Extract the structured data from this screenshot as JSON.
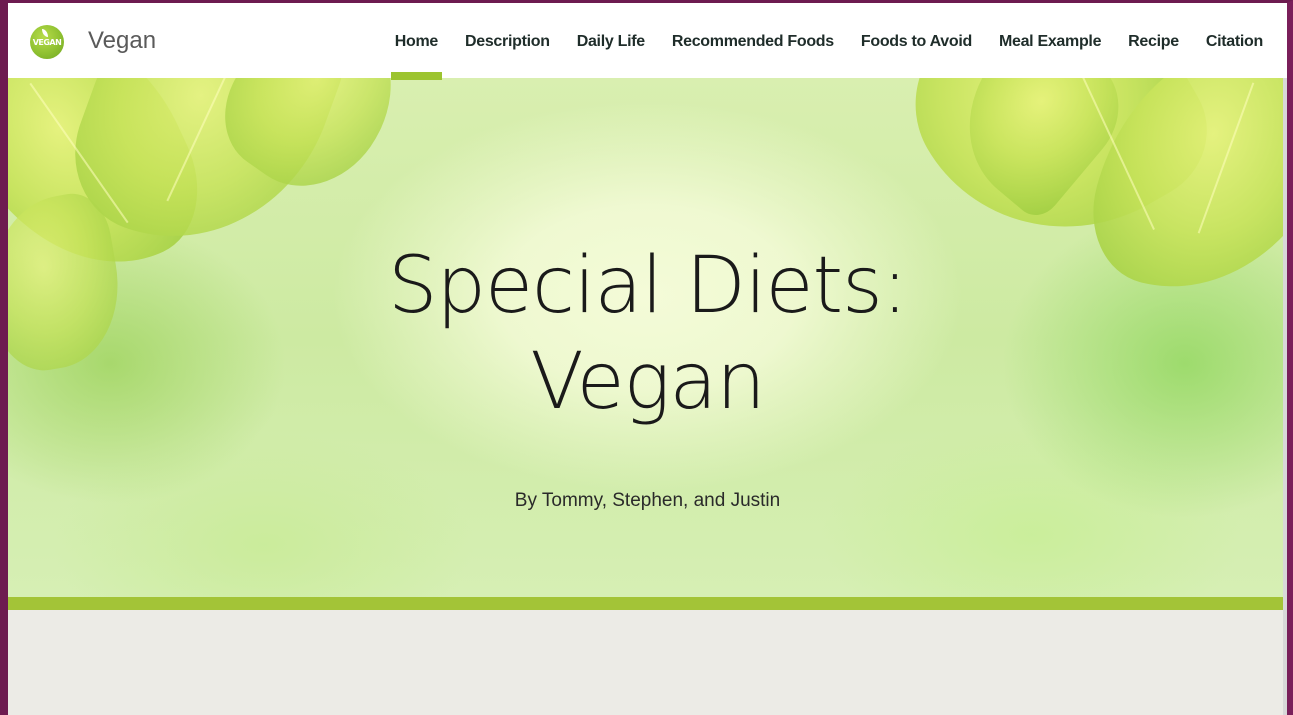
{
  "site": {
    "logo_icon": "vegan-logo-icon",
    "logo_text": "VEGAN",
    "title": "Vegan",
    "accent_color": "#9cc42f"
  },
  "nav": {
    "items": [
      {
        "label": "Home",
        "active": true
      },
      {
        "label": "Description",
        "active": false
      },
      {
        "label": "Daily Life",
        "active": false
      },
      {
        "label": "Recommended Foods",
        "active": false
      },
      {
        "label": "Foods to Avoid",
        "active": false
      },
      {
        "label": "Meal Example",
        "active": false
      },
      {
        "label": "Recipe",
        "active": false
      },
      {
        "label": "Citation",
        "active": false
      }
    ]
  },
  "hero": {
    "title_line1": "Special Diets:",
    "title_line2": "Vegan",
    "subtitle": "By Tommy, Stephen, and Justin",
    "background_image": "green-leaves-image"
  }
}
